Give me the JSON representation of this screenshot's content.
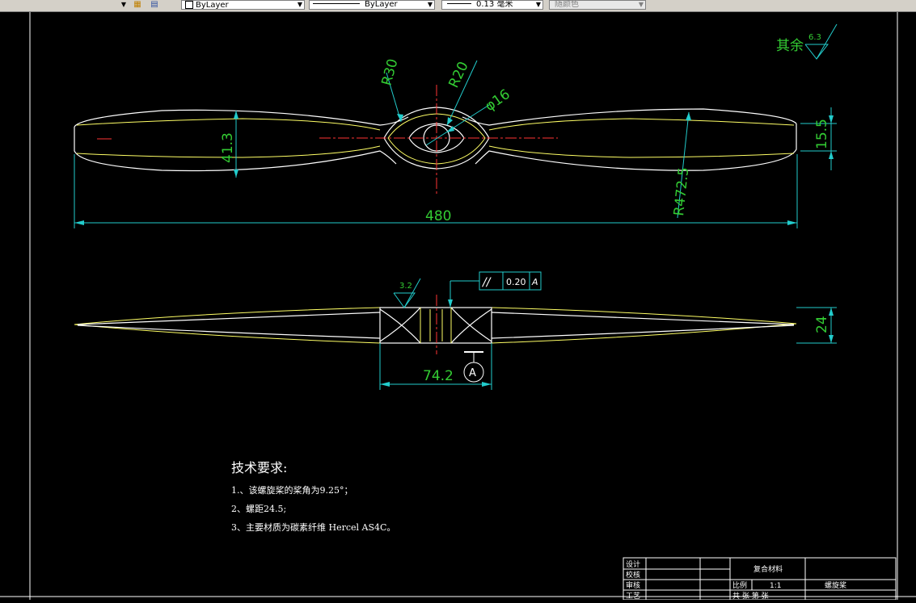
{
  "toolbar": {
    "layer_value": "ByLayer",
    "linetype_value": "ByLayer",
    "lineweight_value": "0.13 毫米",
    "color_value": "随颜色"
  },
  "drawing": {
    "roughness_label": "其余",
    "roughness_value": "6.3",
    "dims": {
      "r30": "R30",
      "r20": "R20",
      "phi16": "φ16",
      "d413": "41.3",
      "d155": "15.5",
      "r4725": "R472.5",
      "d480": "480",
      "d24": "24",
      "d742": "74.2",
      "rough32": "3.2",
      "datum": "A"
    },
    "tolerance": {
      "symbol": "//",
      "value": "0.20",
      "datum": "A"
    },
    "notes": {
      "title": "技术要求:",
      "line1": "1.、该螺旋桨的桨角为9.25°；",
      "line2": "2、螺距24.5;",
      "line3": "3、主要材质为碳素纤维 Hercel AS4C。"
    },
    "title_block": {
      "design": "设计",
      "check": "校核",
      "review": "审核",
      "craft": "工艺",
      "material": "复合材料",
      "scale_label": "比例",
      "scale_value": "1:1",
      "part_name": "螺旋桨",
      "sheets": "共  张  第  张"
    }
  }
}
